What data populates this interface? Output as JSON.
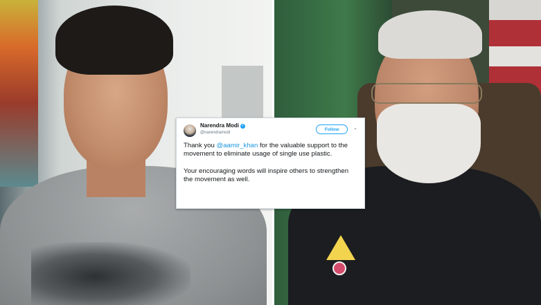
{
  "tweet": {
    "author_name": "Narendra Modi",
    "author_handle": "@narendramodi",
    "follow_label": "Follow",
    "text_prefix": "Thank you ",
    "mention": "@aamir_khan",
    "text_rest": " for the valuable support to the movement to eliminate usage of single use plastic.",
    "text_second": "Your encouraging words will inspire others to strengthen the movement as well.",
    "link_color": "#1b95e0",
    "icons": [
      "verified-icon",
      "chevron-down-icon"
    ]
  }
}
